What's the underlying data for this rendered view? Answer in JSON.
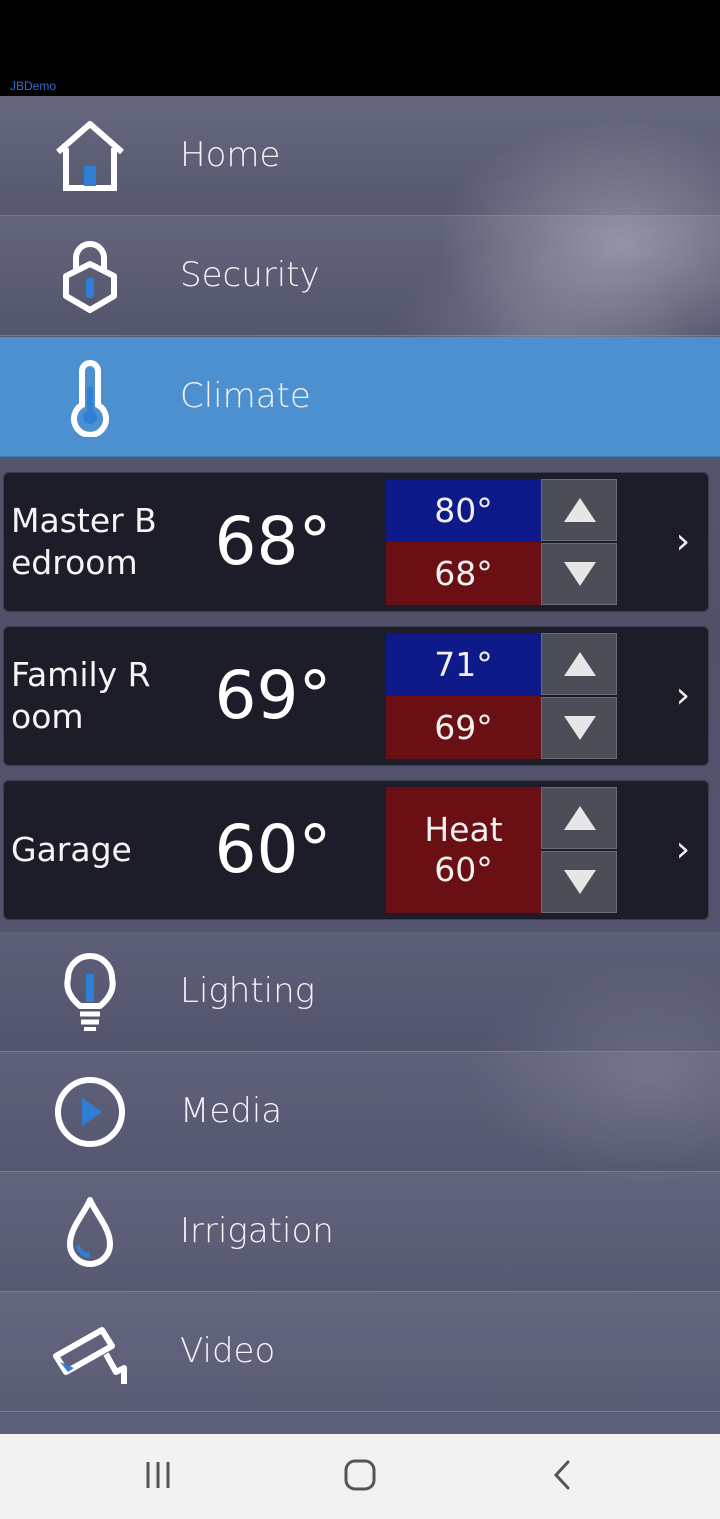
{
  "app": {
    "name": "JBDemo"
  },
  "nav": {
    "items": [
      {
        "label": "Home",
        "icon": "home-icon"
      },
      {
        "label": "Security",
        "icon": "lock-icon"
      },
      {
        "label": "Climate",
        "icon": "thermometer-icon",
        "active": true
      }
    ],
    "items_after": [
      {
        "label": "Lighting",
        "icon": "lightbulb-icon"
      },
      {
        "label": "Media",
        "icon": "play-icon"
      },
      {
        "label": "Irrigation",
        "icon": "water-drop-icon"
      },
      {
        "label": "Video",
        "icon": "camera-icon"
      }
    ]
  },
  "zones": [
    {
      "name": "Master Bedroom",
      "temp": "68°",
      "cool": "80°",
      "heat": "68°"
    },
    {
      "name": "Family Room",
      "temp": "69°",
      "cool": "71°",
      "heat": "69°"
    },
    {
      "name": "Garage",
      "temp": "60°",
      "mode": "Heat",
      "heat": "60°"
    }
  ],
  "colors": {
    "accent": "#4c90cf",
    "cool": "#0f1a8a",
    "heat": "#6a1014",
    "icon_fill": "#2f7fd6"
  },
  "system_nav": {
    "recents": "recents-icon",
    "home": "home-circle-icon",
    "back": "back-icon"
  }
}
